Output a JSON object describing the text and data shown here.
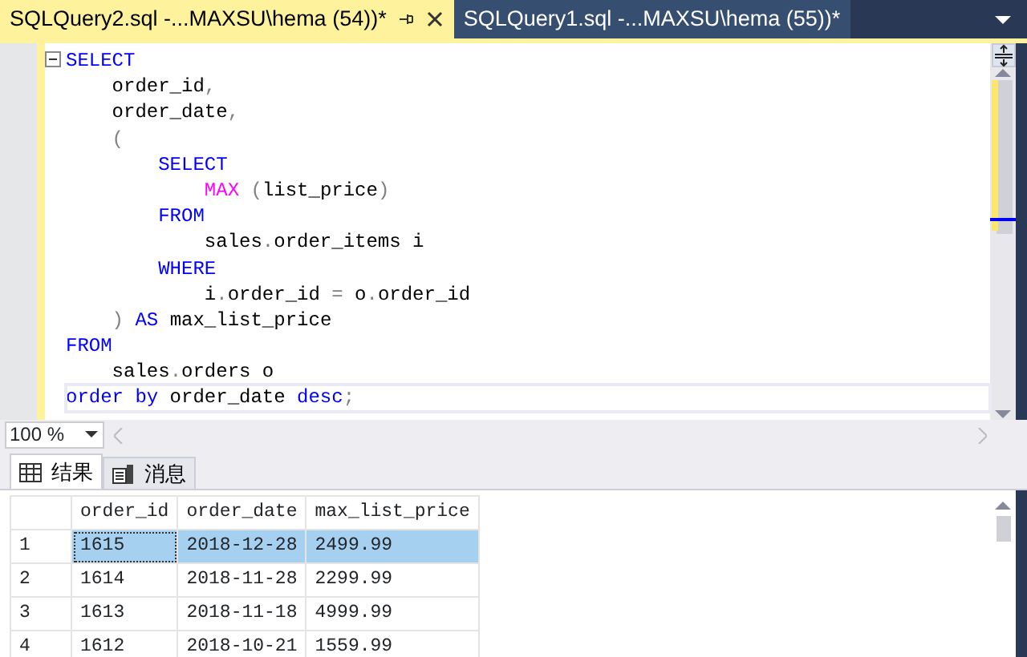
{
  "document_tabs": [
    {
      "label": "SQLQuery2.sql -...MAXSU\\hema (54))*",
      "selected": true
    },
    {
      "label": "SQLQuery1.sql -...MAXSU\\hema (55))*",
      "selected": false
    }
  ],
  "editor": {
    "lines": [
      {
        "fold": true,
        "segments": [
          {
            "kind": "kw",
            "text": "SELECT"
          }
        ]
      },
      {
        "segments": [
          {
            "kind": "txt",
            "text": "    order_id"
          },
          {
            "kind": "op",
            "text": ","
          }
        ]
      },
      {
        "segments": [
          {
            "kind": "txt",
            "text": "    order_date"
          },
          {
            "kind": "op",
            "text": ","
          }
        ]
      },
      {
        "segments": [
          {
            "kind": "op",
            "text": "    ("
          }
        ]
      },
      {
        "segments": [
          {
            "kind": "kw",
            "text": "        SELECT"
          }
        ]
      },
      {
        "segments": [
          {
            "kind": "fn",
            "text": "            MAX"
          },
          {
            "kind": "op",
            "text": " ("
          },
          {
            "kind": "txt",
            "text": "list_price"
          },
          {
            "kind": "op",
            "text": ")"
          }
        ]
      },
      {
        "segments": [
          {
            "kind": "kw",
            "text": "        FROM"
          }
        ]
      },
      {
        "segments": [
          {
            "kind": "txt",
            "text": "            sales"
          },
          {
            "kind": "op",
            "text": "."
          },
          {
            "kind": "txt",
            "text": "order_items i"
          }
        ]
      },
      {
        "segments": [
          {
            "kind": "kw",
            "text": "        WHERE"
          }
        ]
      },
      {
        "segments": [
          {
            "kind": "txt",
            "text": "            i"
          },
          {
            "kind": "op",
            "text": "."
          },
          {
            "kind": "txt",
            "text": "order_id "
          },
          {
            "kind": "op",
            "text": "="
          },
          {
            "kind": "txt",
            "text": " o"
          },
          {
            "kind": "op",
            "text": "."
          },
          {
            "kind": "txt",
            "text": "order_id"
          }
        ]
      },
      {
        "segments": [
          {
            "kind": "op",
            "text": "    )"
          },
          {
            "kind": "kw",
            "text": " AS"
          },
          {
            "kind": "txt",
            "text": " max_list_price"
          }
        ]
      },
      {
        "segments": [
          {
            "kind": "kw",
            "text": "FROM"
          }
        ]
      },
      {
        "segments": [
          {
            "kind": "txt",
            "text": "    sales"
          },
          {
            "kind": "op",
            "text": "."
          },
          {
            "kind": "txt",
            "text": "orders o"
          }
        ]
      },
      {
        "current": true,
        "segments": [
          {
            "kind": "kw",
            "text": "order by"
          },
          {
            "kind": "txt",
            "text": " order_date "
          },
          {
            "kind": "kw",
            "text": "desc"
          },
          {
            "kind": "op",
            "text": ";"
          }
        ]
      }
    ]
  },
  "zoom": "100 %",
  "result_tabs": [
    {
      "label": "结果",
      "kind": "grid",
      "selected": true
    },
    {
      "label": "消息",
      "kind": "messages",
      "selected": false
    }
  ],
  "grid": {
    "columns": [
      "order_id",
      "order_date",
      "max_list_price"
    ],
    "rows": [
      {
        "number": "1",
        "cells": [
          "1615",
          "2018-12-28",
          "2499.99"
        ],
        "selected": true
      },
      {
        "number": "2",
        "cells": [
          "1614",
          "2018-11-28",
          "2299.99"
        ],
        "selected": false
      },
      {
        "number": "3",
        "cells": [
          "1613",
          "2018-11-18",
          "4999.99"
        ],
        "selected": false
      },
      {
        "number": "4",
        "cells": [
          "1612",
          "2018-10-21",
          "1559.99"
        ],
        "selected": false
      }
    ]
  }
}
